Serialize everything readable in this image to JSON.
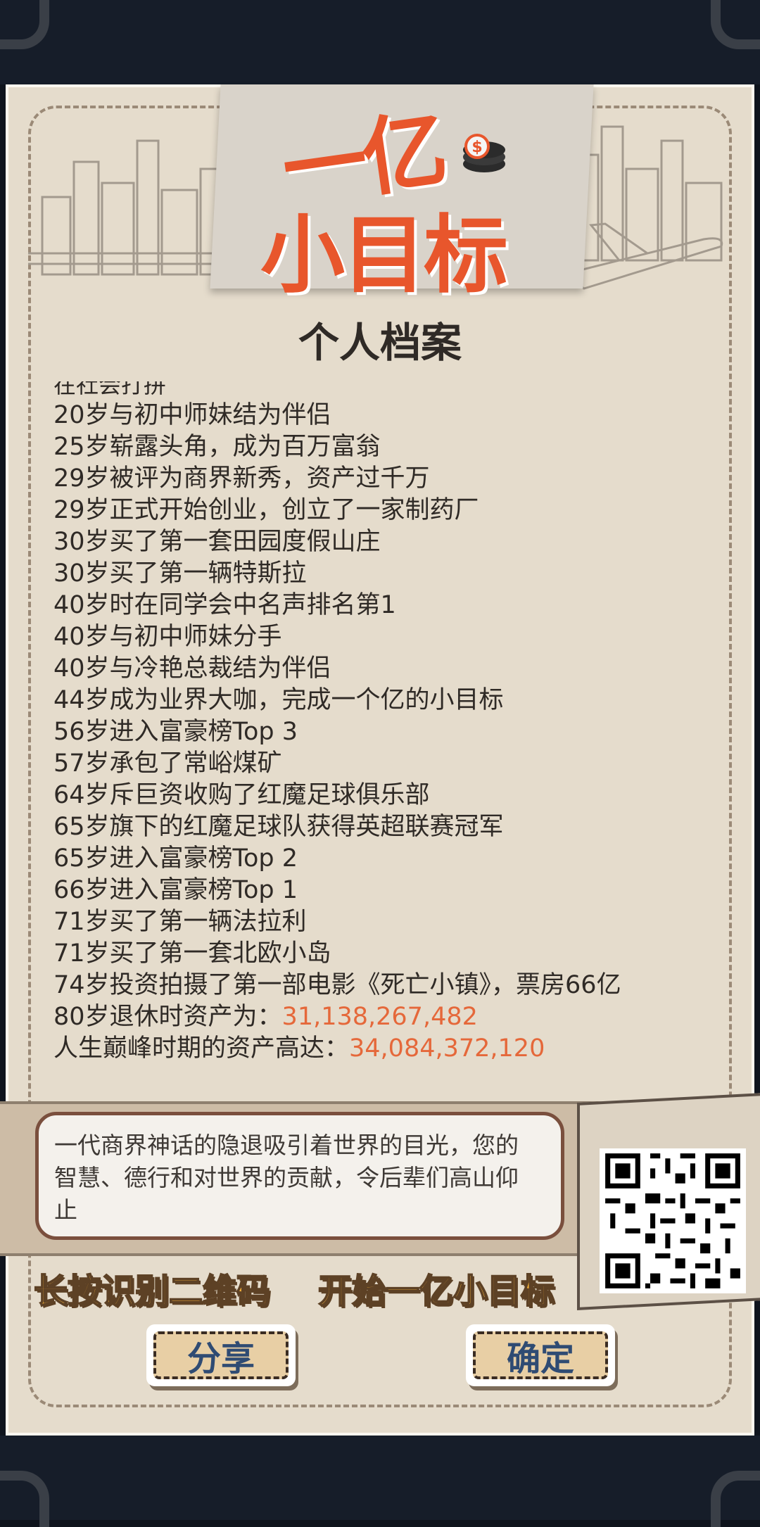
{
  "game": {
    "logo_line1": "一亿",
    "logo_line2": "小目标",
    "title": "个人档案"
  },
  "life_events": [
    "在社会打拼",
    "20岁与初中师妹结为伴侣",
    "25岁崭露头角，成为百万富翁",
    "29岁被评为商界新秀，资产过千万",
    "29岁正式开始创业，创立了一家制药厂",
    "30岁买了第一套田园度假山庄",
    "30岁买了第一辆特斯拉",
    "40岁时在同学会中名声排名第1",
    "40岁与初中师妹分手",
    "40岁与冷艳总裁结为伴侣",
    "44岁成为业界大咖，完成一个亿的小目标",
    "56岁进入富豪榜Top 3",
    "57岁承包了常峪煤矿",
    "64岁斥巨资收购了红魔足球俱乐部",
    "65岁旗下的红魔足球队获得英超联赛冠军",
    "65岁进入富豪榜Top 2",
    "66岁进入富豪榜Top 1",
    "71岁买了第一辆法拉利",
    "71岁买了第一套北欧小岛",
    "74岁投资拍摄了第一部电影《死亡小镇》，票房66亿"
  ],
  "assets": {
    "retire_label": "80岁退休时资产为：",
    "retire_value": "31,138,267,482",
    "peak_label": "人生巅峰时期的资产高达：",
    "peak_value": "34,084,372,120"
  },
  "summary": {
    "text": "一代商界神话的隐退吸引着世界的目光，您的智慧、德行和对世界的贡献，令后辈们高山仰止"
  },
  "captions": {
    "left": "长按识别二维码",
    "right": "开始一亿小目标"
  },
  "buttons": {
    "share": "分享",
    "ok": "确定"
  },
  "colors": {
    "accent": "#e8562c",
    "asset_value": "#e5683a",
    "paper": "#e5dccc",
    "caption": "#f6b23b"
  }
}
